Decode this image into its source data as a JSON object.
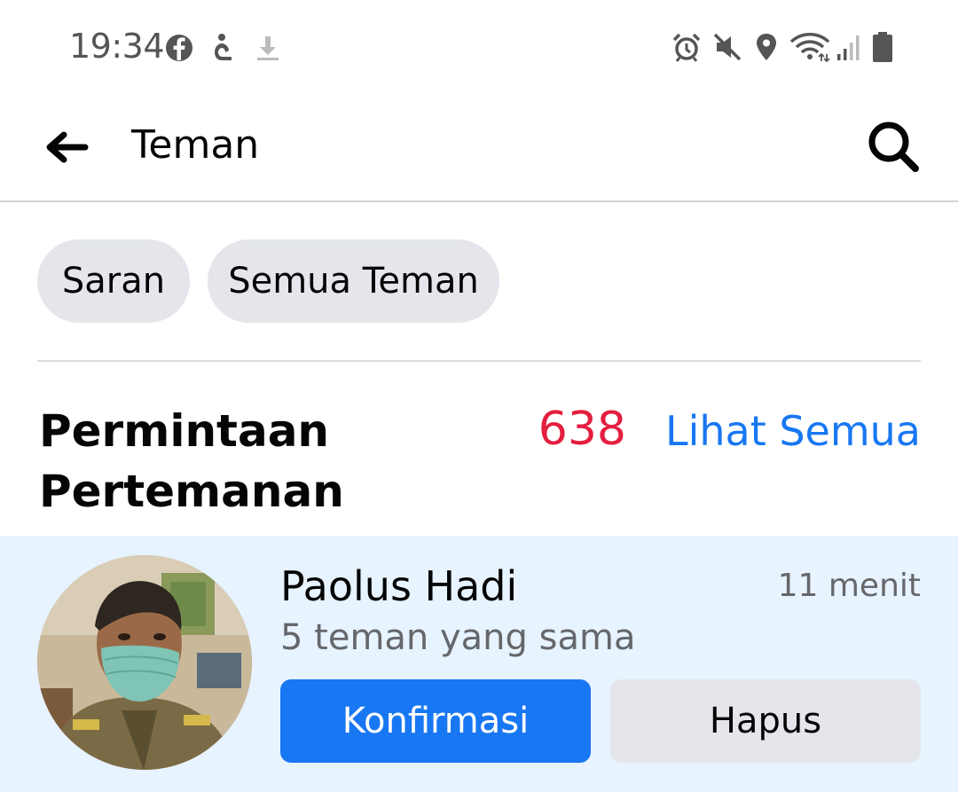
{
  "status_bar": {
    "time": "19:34",
    "left_icons": [
      "facebook-icon",
      "accessibility-icon",
      "download-icon"
    ],
    "right_icons": [
      "alarm-icon",
      "mute-icon",
      "location-icon",
      "wifi-icon",
      "signal-icon",
      "battery-icon"
    ]
  },
  "header": {
    "title": "Teman",
    "back_icon": "arrow-left-icon",
    "search_icon": "search-icon"
  },
  "chips": [
    {
      "label": "Saran"
    },
    {
      "label": "Semua Teman"
    }
  ],
  "requests_section": {
    "title": "Permintaan Pertemanan",
    "count": "638",
    "see_all": "Lihat Semua"
  },
  "request": {
    "name": "Paolus Hadi",
    "time": "11 menit",
    "mutual": "5 teman yang sama",
    "confirm_label": "Konfirmasi",
    "delete_label": "Hapus"
  },
  "colors": {
    "accent": "#1877f2",
    "count": "#e41e3f",
    "card_bg": "#e7f3ff",
    "chip_bg": "#e4e6eb"
  }
}
